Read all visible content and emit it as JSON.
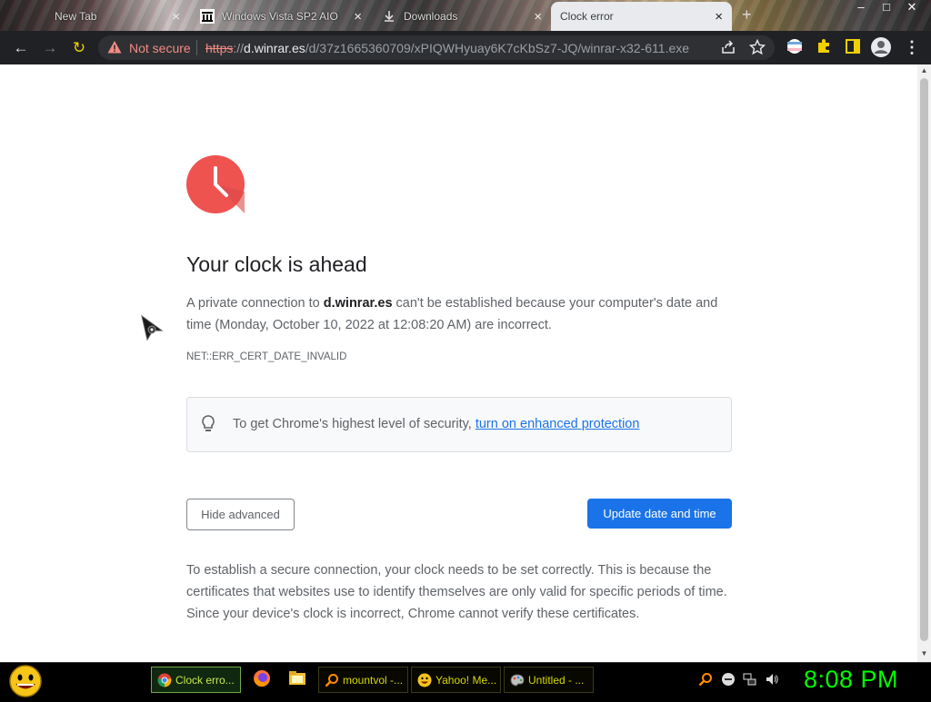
{
  "browser": {
    "tabs": [
      {
        "title": "New Tab",
        "close": "×"
      },
      {
        "title": "Windows Vista SP2 AIO",
        "close": "×"
      },
      {
        "title": "Downloads",
        "close": "×"
      },
      {
        "title": "Clock error",
        "close": "×"
      }
    ],
    "new_tab": "+",
    "security_label": "Not secure",
    "url": {
      "scheme": "https",
      "separator": "://",
      "host": "d.winrar.es",
      "path": "/d/37z1665360709/xPIQWHyuay6K7cKbSz7-JQ/winrar-x32-611.exe"
    },
    "nav_icons": {
      "back": "←",
      "forward": "→",
      "reload": "↻"
    },
    "window_controls": {
      "minimize": "–",
      "maximize": "□",
      "close": "✕"
    }
  },
  "page": {
    "heading": "Your clock is ahead",
    "desc_pre": "A private connection to ",
    "desc_host": "d.winrar.es",
    "desc_post": " can't be established because your computer's date and time (Monday, October 10, 2022 at 12:08:20 AM) are incorrect.",
    "error_code": "NET::ERR_CERT_DATE_INVALID",
    "security_text": "To get Chrome's highest level of security, ",
    "security_link": "turn on enhanced protection",
    "hide_advanced": "Hide advanced",
    "update_button": "Update date and time",
    "explanation": "To establish a secure connection, your clock needs to be set correctly. This is because the certificates that websites use to identify themselves are only valid for specific periods of time. Since your device's clock is incorrect, Chrome cannot verify these certificates."
  },
  "taskbar": {
    "buttons": [
      {
        "label": "Clock erro...",
        "icon": "chrome-icon"
      },
      {
        "label": "mountvol -...",
        "icon": "search-icon"
      },
      {
        "label": "Yahoo! Me...",
        "icon": "yahoo-messenger-icon"
      },
      {
        "label": "Untitled - ...",
        "icon": "paint-icon"
      }
    ],
    "time": "8:08 PM"
  },
  "colors": {
    "accent_blue": "#1a73e8",
    "clock_red": "#ef5350",
    "warning_red": "#f28b82",
    "taskbar_time": "#00ff00"
  }
}
